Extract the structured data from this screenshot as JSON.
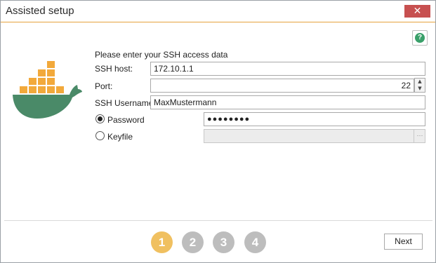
{
  "window": {
    "title": "Assisted setup",
    "close_label": "✕"
  },
  "help": {
    "label": "?"
  },
  "form": {
    "intro": "Please enter your SSH access data",
    "host_label": "SSH host:",
    "host_value": "172.10.1.1",
    "port_label": "Port:",
    "port_value": "22",
    "username_label": "SSH Username:",
    "username_value": "MaxMustermann",
    "auth_options": [
      {
        "label": "Password",
        "selected": true
      },
      {
        "label": "Keyfile",
        "selected": false
      }
    ],
    "password_value": "●●●●●●●●",
    "keyfile_value": "",
    "browse_label": "···"
  },
  "steps": {
    "items": [
      "1",
      "2",
      "3",
      "4"
    ],
    "current": 1
  },
  "footer": {
    "next_label": "Next"
  },
  "colors": {
    "accent": "#e6a23c",
    "step_active": "#f0c060",
    "step_inactive": "#bdbdbd",
    "docker_container": "#f2a93b",
    "whale": "#4a8a68",
    "close": "#c75050"
  },
  "icons": {
    "logo": "docker-whale-logo",
    "help": "help-icon",
    "close": "close-icon"
  }
}
